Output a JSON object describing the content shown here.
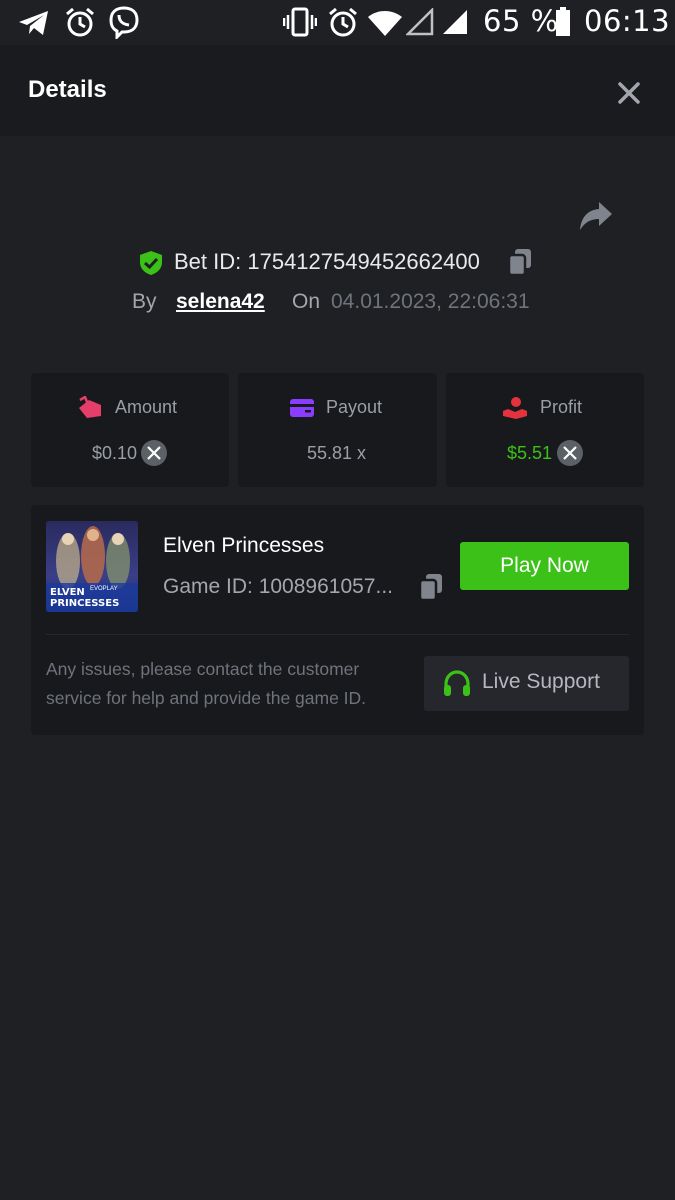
{
  "status_bar": {
    "battery": "65 %",
    "time": "06:13"
  },
  "header": {
    "title": "Details"
  },
  "bet": {
    "id_label": "Bet ID: 1754127549452662400",
    "by_label": "By",
    "username": "selena42",
    "on_label": "On",
    "datetime": "04.01.2023, 22:06:31"
  },
  "stats": [
    {
      "label": "Amount",
      "value": "$0.10",
      "color": "#9a9ea6"
    },
    {
      "label": "Payout",
      "value": "55.81 x",
      "color": "#9a9ea6"
    },
    {
      "label": "Profit",
      "value": "$5.51",
      "color": "#3bc117"
    }
  ],
  "game": {
    "thumbnail_title": "ELVEN PRINCESSES",
    "thumbnail_brand": "EVOPLAY",
    "name": "Elven Princesses",
    "id_label": "Game ID: 1008961057...",
    "play_label": "Play Now"
  },
  "support": {
    "message": "Any issues, please contact the customer service for help and provide the game ID.",
    "button_label": "Live Support"
  },
  "colors": {
    "background": "#1f2024",
    "accent_green": "#3bc117",
    "amount_icon": "#e53e6a",
    "payout_icon": "#8b3dff",
    "profit_icon": "#e5323f"
  }
}
